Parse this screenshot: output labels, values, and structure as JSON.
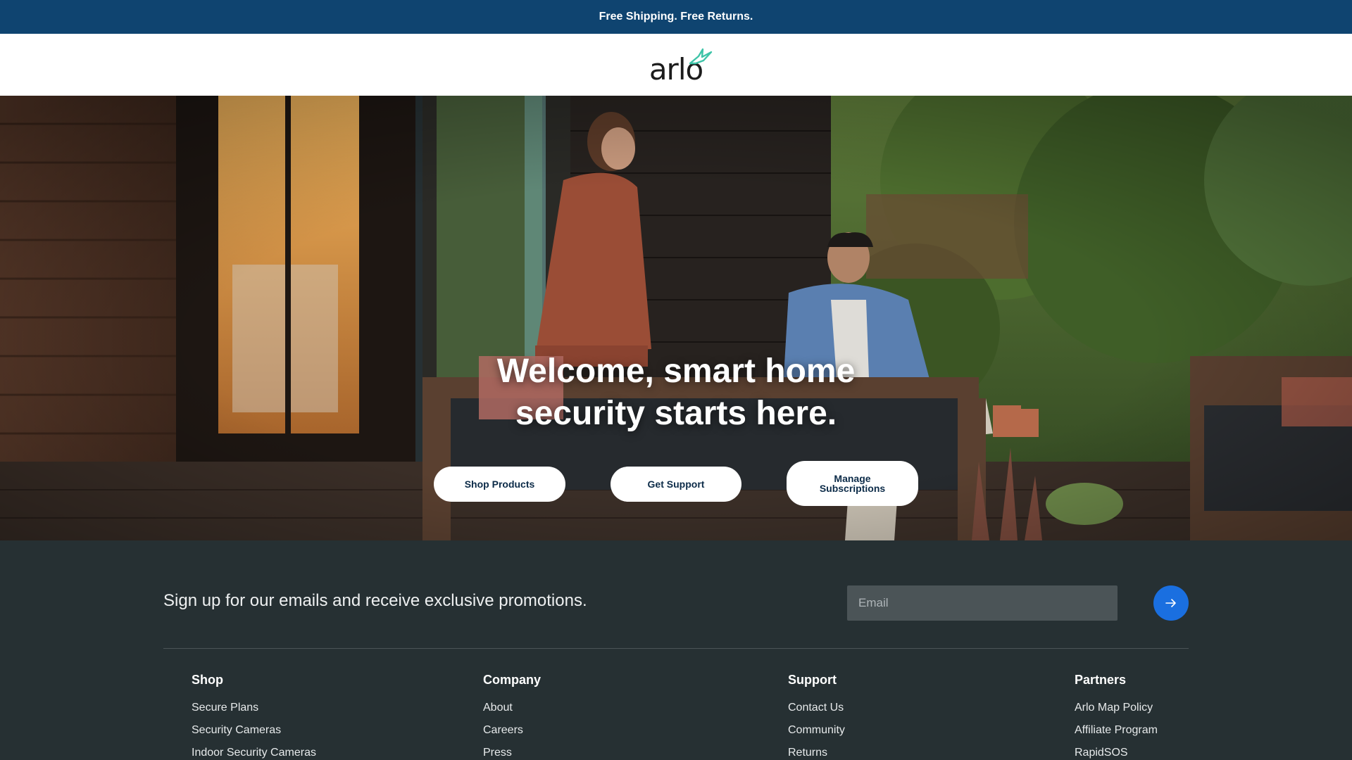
{
  "promo": {
    "text": "Free Shipping. Free Returns."
  },
  "header": {
    "logo_text": "arlo"
  },
  "hero": {
    "title_line1": "Welcome, smart home",
    "title_line2": "security starts here.",
    "buttons": {
      "shop": "Shop Products",
      "support": "Get Support",
      "manage_line1": "Manage",
      "manage_line2": "Subscriptions"
    }
  },
  "signup": {
    "text": "Sign up for our emails and receive exclusive promotions.",
    "email_placeholder": "Email",
    "submit_icon": "arrow-right-icon"
  },
  "footer_columns": [
    {
      "title": "Shop",
      "links": [
        "Secure Plans",
        "Security Cameras",
        "Indoor Security Cameras"
      ]
    },
    {
      "title": "Company",
      "links": [
        "About",
        "Careers",
        "Press"
      ]
    },
    {
      "title": "Support",
      "links": [
        "Contact Us",
        "Community",
        "Returns"
      ]
    },
    {
      "title": "Partners",
      "links": [
        "Arlo Map Policy",
        "Affiliate Program",
        "RapidSOS"
      ]
    }
  ],
  "colors": {
    "promo_bg": "#0f4470",
    "footer_bg": "#263033",
    "accent_blue": "#1a6fe0",
    "logo_green": "#3ec4a8"
  }
}
